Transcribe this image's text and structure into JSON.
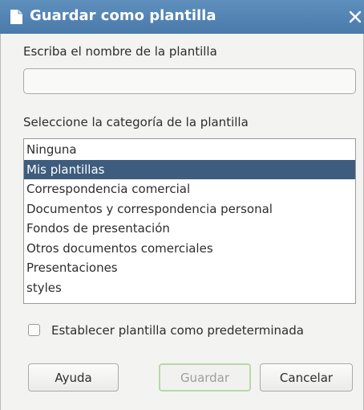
{
  "dialog": {
    "title": "Guardar como plantilla",
    "title_icon": "document-icon",
    "close_icon": "close-icon",
    "colors": {
      "titlebar": "#4a7aaa",
      "selection": "#3e5c7e",
      "body": "#f3f3f1"
    }
  },
  "name_section": {
    "label": "Escriba el nombre de la plantilla",
    "value": "",
    "placeholder": ""
  },
  "category_section": {
    "label": "Seleccione la categoría de la plantilla",
    "selected": "Mis plantillas",
    "items": [
      "Ninguna",
      "Mis plantillas",
      "Correspondencia comercial",
      "Documentos y correspondencia personal",
      "Fondos de presentación",
      "Otros documentos comerciales",
      "Presentaciones",
      "styles"
    ]
  },
  "default_checkbox": {
    "label": "Establecer plantilla como predeterminada",
    "checked": false
  },
  "buttons": {
    "help": "Ayuda",
    "save": "Guardar",
    "cancel": "Cancelar"
  }
}
